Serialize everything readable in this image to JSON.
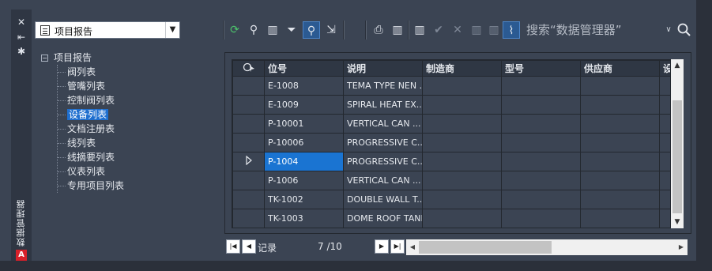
{
  "palette": "Data Manager",
  "sidebar_title": "数据管理器",
  "app_logo": "A",
  "project_dropdown": {
    "selected": "项目报告"
  },
  "tree": {
    "root": "项目报告",
    "items": [
      {
        "label": "阀列表",
        "selected": false
      },
      {
        "label": "管嘴列表",
        "selected": false
      },
      {
        "label": "控制阀列表",
        "selected": false
      },
      {
        "label": "设备列表",
        "selected": true
      },
      {
        "label": "文档注册表",
        "selected": false
      },
      {
        "label": "线列表",
        "selected": false
      },
      {
        "label": "线摘要列表",
        "selected": false
      },
      {
        "label": "仪表列表",
        "selected": false
      },
      {
        "label": "专用项目列表",
        "selected": false
      }
    ]
  },
  "search": {
    "placeholder": "搜索“数据管理器”"
  },
  "grid": {
    "columns": [
      "位号",
      "说明",
      "制造商",
      "型号",
      "供应商",
      "设"
    ],
    "rows": [
      {
        "tag": "E-1008",
        "desc": "TEMA TYPE NEN ...",
        "current": false
      },
      {
        "tag": "E-1009",
        "desc": "SPIRAL HEAT EX...",
        "current": false
      },
      {
        "tag": "P-10001",
        "desc": "VERTICAL CAN ...",
        "current": false
      },
      {
        "tag": "P-10006",
        "desc": "PROGRESSIVE C...",
        "current": false
      },
      {
        "tag": "P-1004",
        "desc": "PROGRESSIVE C...",
        "current": true
      },
      {
        "tag": "P-1006",
        "desc": "VERTICAL CAN ...",
        "current": false
      },
      {
        "tag": "TK-1002",
        "desc": "DOUBLE WALL T...",
        "current": false
      },
      {
        "tag": "TK-1003",
        "desc": "DOME ROOF TANK",
        "current": false
      }
    ]
  },
  "record_nav": {
    "label": "记录",
    "count": "7 /10"
  }
}
